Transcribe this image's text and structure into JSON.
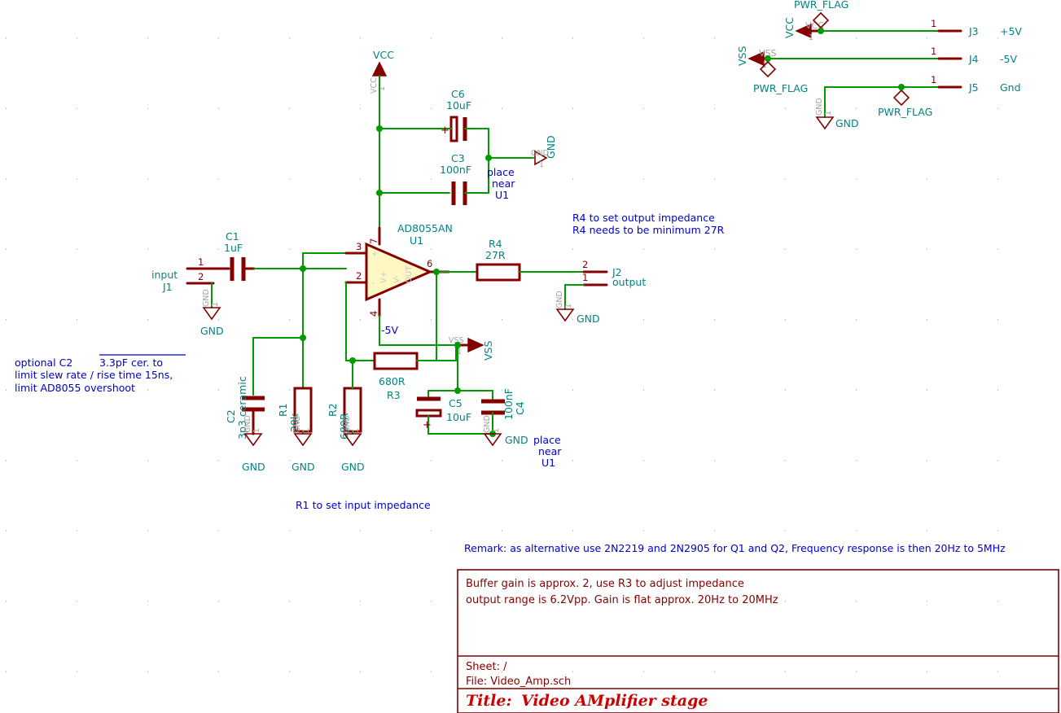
{
  "sheet": {
    "title_prefix": "Title:",
    "title": "Video AMplifier stage",
    "sheet_label": "Sheet: /",
    "file_label": "File: Video_Amp.sch",
    "note_line1": "Buffer gain is approx. 2,  use R3 to adjust impedance",
    "note_line2": "output range is 6.2Vpp. Gain is flat  approx. 20Hz to 20MHz",
    "remark": "Remark: as alternative use 2N2219 and 2N2905 for Q1 and Q2, Frequency response is then 20Hz to 5MHz"
  },
  "colors": {
    "wire": "#009900",
    "component": "#840000",
    "label": "#008484",
    "note": "#0000c8",
    "title": "#cc0000",
    "opamp_fill": "#fff8c4",
    "background": "#ffffff",
    "grid_dot": "#b9b9b9"
  },
  "notes": {
    "r4_note_line1": "R4 to set output impedance",
    "r4_note_line2": "R4 needs to be minimum 27R",
    "r1_note": "R1 to set input impedance",
    "c2_note_line1": "optional  C2",
    "c2_note_overline": "3.3pF cer. to",
    "c2_note_line2": "limit slew rate / rise time 15ns,",
    "c2_note_line3": "limit  AD8055 overshoot",
    "place_near_u1_top": [
      "place",
      "near",
      "U1"
    ],
    "place_near_u1_bottom": [
      "place",
      "near",
      "U1"
    ],
    "minus5v": "-5V"
  },
  "components": {
    "u1": {
      "ref": "U1",
      "value": "AD8055AN",
      "pins": [
        "3",
        "2",
        "6",
        "7",
        "4"
      ],
      "pin_names": [
        "+",
        "-",
        "OUT",
        "V+",
        "V-"
      ]
    },
    "c1": {
      "ref": "C1",
      "value": "1uF"
    },
    "c2": {
      "ref": "C2",
      "value": "3p3 ceramic"
    },
    "c3": {
      "ref": "C3",
      "value": "100nF"
    },
    "c4": {
      "ref": "C4",
      "value": "100nF"
    },
    "c5": {
      "ref": "C5",
      "value": "10uF",
      "polarity": "+"
    },
    "c6": {
      "ref": "C6",
      "value": "10uF",
      "polarity": "+"
    },
    "r1": {
      "ref": "R1",
      "value": "20k"
    },
    "r2": {
      "ref": "R2",
      "value": "680R"
    },
    "r3": {
      "ref": "R3",
      "value": "680R"
    },
    "r4": {
      "ref": "R4",
      "value": "27R"
    }
  },
  "connectors": {
    "j1": {
      "ref": "J1",
      "label": "input",
      "pins": [
        "1",
        "2"
      ]
    },
    "j2": {
      "ref": "J2",
      "label": "output",
      "pins": [
        "2",
        "1"
      ]
    },
    "j3": {
      "ref": "J3",
      "label": "+5V",
      "pin": "1"
    },
    "j4": {
      "ref": "J4",
      "label": "-5V",
      "pin": "1"
    },
    "j5": {
      "ref": "J5",
      "label": "Gnd",
      "pin": "1"
    }
  },
  "power_symbols": {
    "vcc": "VCC",
    "vss": "VSS",
    "gnd": "GND",
    "pwr_flag": "PWR_FLAG",
    "pin_one": "1"
  }
}
